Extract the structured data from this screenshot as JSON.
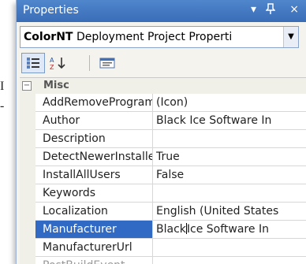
{
  "background_text": {
    "line1": "I",
    "line2": "-"
  },
  "panel": {
    "title": "Properties",
    "controls": {
      "dropdown": "▾",
      "pin": "ᵖ",
      "close": "×"
    }
  },
  "object_selector": {
    "object": "ColorNT",
    "type": "Deployment Project Properti"
  },
  "toolbar": {
    "buttons": [
      {
        "icon": "categorized-icon",
        "active": true
      },
      {
        "icon": "alphabetical-icon",
        "active": false
      },
      {
        "icon": "property-pages-icon",
        "active": false
      }
    ]
  },
  "grid": {
    "category": {
      "toggle": "−",
      "label": "Misc"
    },
    "rows": [
      {
        "name": "AddRemoveProgramsIcon",
        "value": "(Icon)"
      },
      {
        "name": "Author",
        "value": "Black Ice Software In"
      },
      {
        "name": "Description",
        "value": ""
      },
      {
        "name": "DetectNewerInstalledVersion",
        "value": "True"
      },
      {
        "name": "InstallAllUsers",
        "value": "False"
      },
      {
        "name": "Keywords",
        "value": ""
      },
      {
        "name": "Localization",
        "value": "English (United States"
      },
      {
        "name": "Manufacturer",
        "value_before_cursor": "Black",
        "value_after_cursor": "Ice Software In",
        "selected": true
      },
      {
        "name": "ManufacturerUrl",
        "value": ""
      },
      {
        "name": "PostBuildEvent",
        "value": ""
      }
    ]
  }
}
